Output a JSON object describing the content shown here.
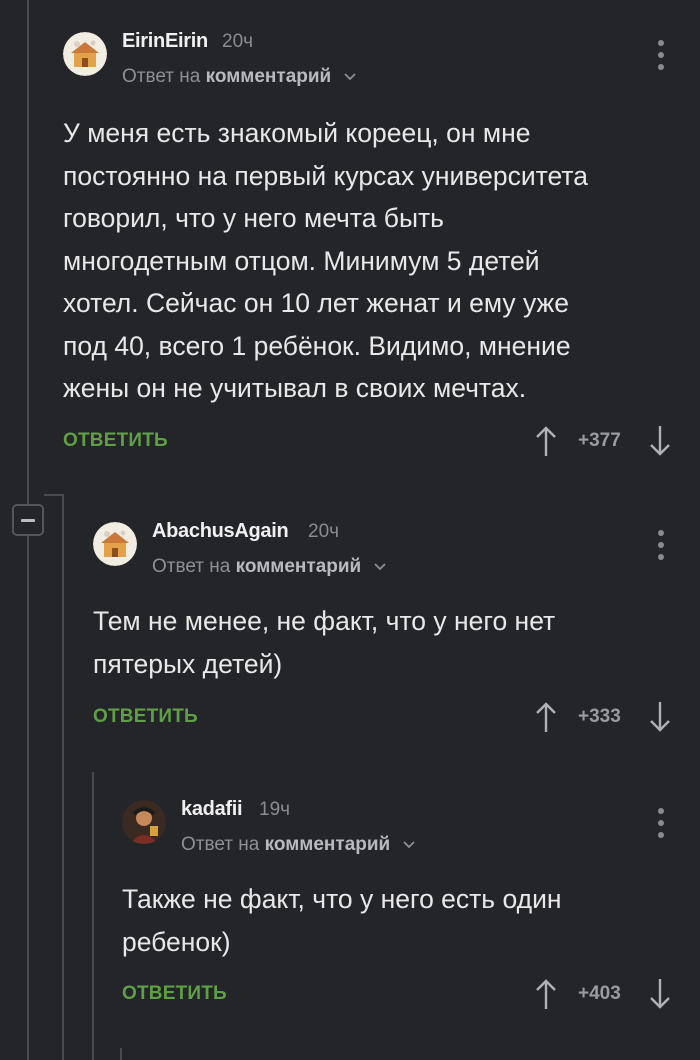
{
  "comments": [
    {
      "author": "EirinEirin",
      "time": "20ч",
      "reply_prefix": "Ответ на",
      "reply_target": "комментарий",
      "avatar_icon": "cartoon-house-avatar",
      "text": "У меня есть знакомый кореец, он мне\nпостоянно на первый курсах университета\nговорил, что у него мечта быть\nмногодетным отцом. Минимум 5 детей\nхотел. Сейчас он 10 лет женат и ему уже\nпод 40, всего 1 ребёнок. Видимо, мнение\nжены он не учитывал в своих мечтах.",
      "reply_label": "ОТВЕТИТЬ",
      "score": "+377"
    },
    {
      "author": "AbachusAgain",
      "time": "20ч",
      "reply_prefix": "Ответ на",
      "reply_target": "комментарий",
      "avatar_icon": "cartoon-house-avatar",
      "text": "Тем не менее, не факт, что у него нет\nпятерых детей)",
      "reply_label": "ОТВЕТИТЬ",
      "score": "+333"
    },
    {
      "author": "kadafii",
      "time": "19ч",
      "reply_prefix": "Ответ на",
      "reply_target": "комментарий",
      "avatar_icon": "photo-avatar",
      "text": "Также не факт, что у него есть один\nребенок)",
      "reply_label": "ОТВЕТИТЬ",
      "score": "+403"
    }
  ],
  "colors": {
    "background": "#242529",
    "reply_green": "#5f9f45",
    "thread_line": "#4a4b50",
    "muted_text": "#8a8b8f"
  },
  "icons": {
    "more": "more-vertical-icon",
    "upvote": "arrow-up-icon",
    "downvote": "arrow-down-icon",
    "collapse": "minus-icon",
    "dropdown": "chevron-down-icon"
  }
}
